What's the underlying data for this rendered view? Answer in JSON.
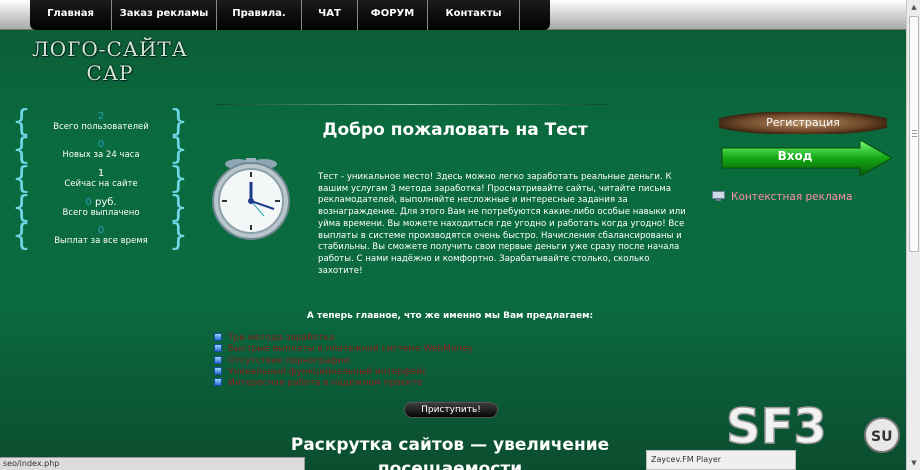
{
  "nav": [
    {
      "label": "Главная"
    },
    {
      "label": "Заказ рекламы"
    },
    {
      "label": "Правила."
    },
    {
      "label": "ЧАТ"
    },
    {
      "label": "ФОРУМ"
    },
    {
      "label": "Контакты"
    }
  ],
  "logo": {
    "line1": "ЛОГО-САЙТА",
    "line2": "САР"
  },
  "stats": [
    {
      "value": "2",
      "label": "Всего пользователей"
    },
    {
      "value": "0",
      "label": "Новых за 24 часа"
    },
    {
      "value": "1",
      "label": "Сейчас на сайте"
    },
    {
      "value": "0",
      "unit": "руб.",
      "label": "Всего выплачено"
    },
    {
      "value": "0",
      "label": "Выплат за все время"
    }
  ],
  "welcome": "Добро пожаловать на Тест",
  "intro": "Тест - уникальное место! Здесь можно легко заработать реальные деньги. К вашим услугам 3 метода заработка! Просматривайте сайты, читайте письма рекламодателей, выполняйте несложные и интересные задания за вознаграждение. Для этого Вам не потребуются какие-либо особые навыки или уйма времени. Вы можете находиться где угодно и работать когда угодно! Все выплаты в системе производятся очень быстро. Начисления сбалансированы и стабильны. Вы сможете получить свои первые деньги уже сразу после начала работы. С нами надёжно и комфортно. Зарабатывайте столько, сколько захотите!",
  "register_label": "Регистрация",
  "login_label": "Вход",
  "context_ad_label": "Контекстная реклама",
  "offer_title": "А теперь главное, что же именно мы Вам предлагаем:",
  "features": [
    "Три метода заработка",
    "Быстрые выплаты в платежной системе WebMoney",
    "Отсутствие порнографии",
    "Уникальный функциональный интерфейс",
    "Интересная работа в надежном проекте"
  ],
  "start_label": "Приступить!",
  "seo_title_line1": "Раскрутка сайтов — увеличение",
  "seo_title_line2": "посещаемости",
  "status_url": "seo/index.php",
  "player_label": "Zaycev.FM Player",
  "watermark": {
    "text": "SF3",
    "badge": "SU"
  },
  "colors": {
    "accent_green": "#0a6b3e",
    "feature_link": "#8a1b1b",
    "context_ad": "#ff8fa8"
  }
}
